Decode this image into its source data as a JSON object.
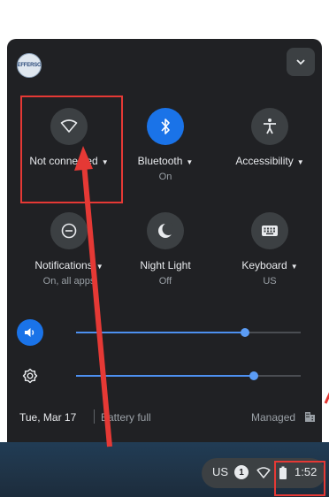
{
  "colors": {
    "panel_bg": "#202124",
    "tile_bg": "#3c4043",
    "accent_blue": "#1a73e8",
    "annotation_red": "#e53935",
    "shelf_bg": "#1f3346"
  },
  "header": {
    "avatar_text": "EFFERSO",
    "avatar_icon": "school-seal-avatar",
    "collapse_icon": "chevron-down-icon"
  },
  "tiles": [
    {
      "label": "Not connected",
      "sub": "",
      "icon": "wifi-off-icon",
      "active": false,
      "has_menu": true
    },
    {
      "label": "Bluetooth",
      "sub": "On",
      "icon": "bluetooth-icon",
      "active": true,
      "has_menu": true
    },
    {
      "label": "Accessibility",
      "sub": "",
      "icon": "accessibility-icon",
      "active": false,
      "has_menu": true
    },
    {
      "label": "Notifications",
      "sub": "On, all apps",
      "icon": "notifications-icon",
      "active": false,
      "has_menu": true
    },
    {
      "label": "Night Light",
      "sub": "Off",
      "icon": "night-light-icon",
      "active": false,
      "has_menu": false
    },
    {
      "label": "Keyboard",
      "sub": "US",
      "icon": "keyboard-icon",
      "active": false,
      "has_menu": true
    }
  ],
  "sliders": {
    "volume": {
      "icon": "volume-icon",
      "level": 0.75
    },
    "brightness": {
      "icon": "brightness-icon",
      "level": 0.79
    }
  },
  "footer": {
    "date": "Tue, Mar 17",
    "battery": "Battery full",
    "managed": "Managed",
    "managed_icon": "managed-building-icon"
  },
  "shelf": {
    "keyboard_layout": "US",
    "notification_count": "1",
    "time": "1:52",
    "wifi_icon": "wifi-icon",
    "battery_icon": "battery-icon"
  }
}
